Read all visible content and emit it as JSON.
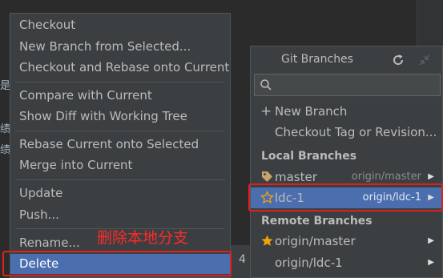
{
  "background": {
    "fragments": [
      "是歹",
      "绩",
      "绩"
    ],
    "status_number": "4"
  },
  "context_menu": {
    "items": [
      {
        "label": "Checkout"
      },
      {
        "label": "New Branch from Selected..."
      },
      {
        "label": "Checkout and Rebase onto Current"
      },
      {
        "label": "Compare with Current"
      },
      {
        "label": "Show Diff with Working Tree"
      },
      {
        "label": "Rebase Current onto Selected"
      },
      {
        "label": "Merge into Current"
      },
      {
        "label": "Update"
      },
      {
        "label": "Push..."
      },
      {
        "label": "Rename..."
      },
      {
        "label": "Delete",
        "selected": true
      }
    ]
  },
  "annotation": "删除本地分支",
  "git_branches": {
    "title": "Git Branches",
    "search_placeholder": "",
    "actions": [
      {
        "label": "New Branch",
        "prefix": "+"
      },
      {
        "label": "Checkout Tag or Revision..."
      }
    ],
    "local_header": "Local Branches",
    "local": [
      {
        "name": "master",
        "tracking": "origin/master",
        "icon": "tag-icon"
      },
      {
        "name": "ldc-1",
        "tracking": "origin/ldc-1",
        "icon": "star-outline-icon",
        "selected": true
      }
    ],
    "remote_header": "Remote Branches",
    "remote": [
      {
        "name": "origin/master",
        "icon": "star-filled-icon"
      },
      {
        "name": "origin/ldc-1"
      }
    ]
  },
  "colors": {
    "selection": "#4b6eaf",
    "highlight_red": "#e02020",
    "star_gold": "#f0a30a"
  }
}
